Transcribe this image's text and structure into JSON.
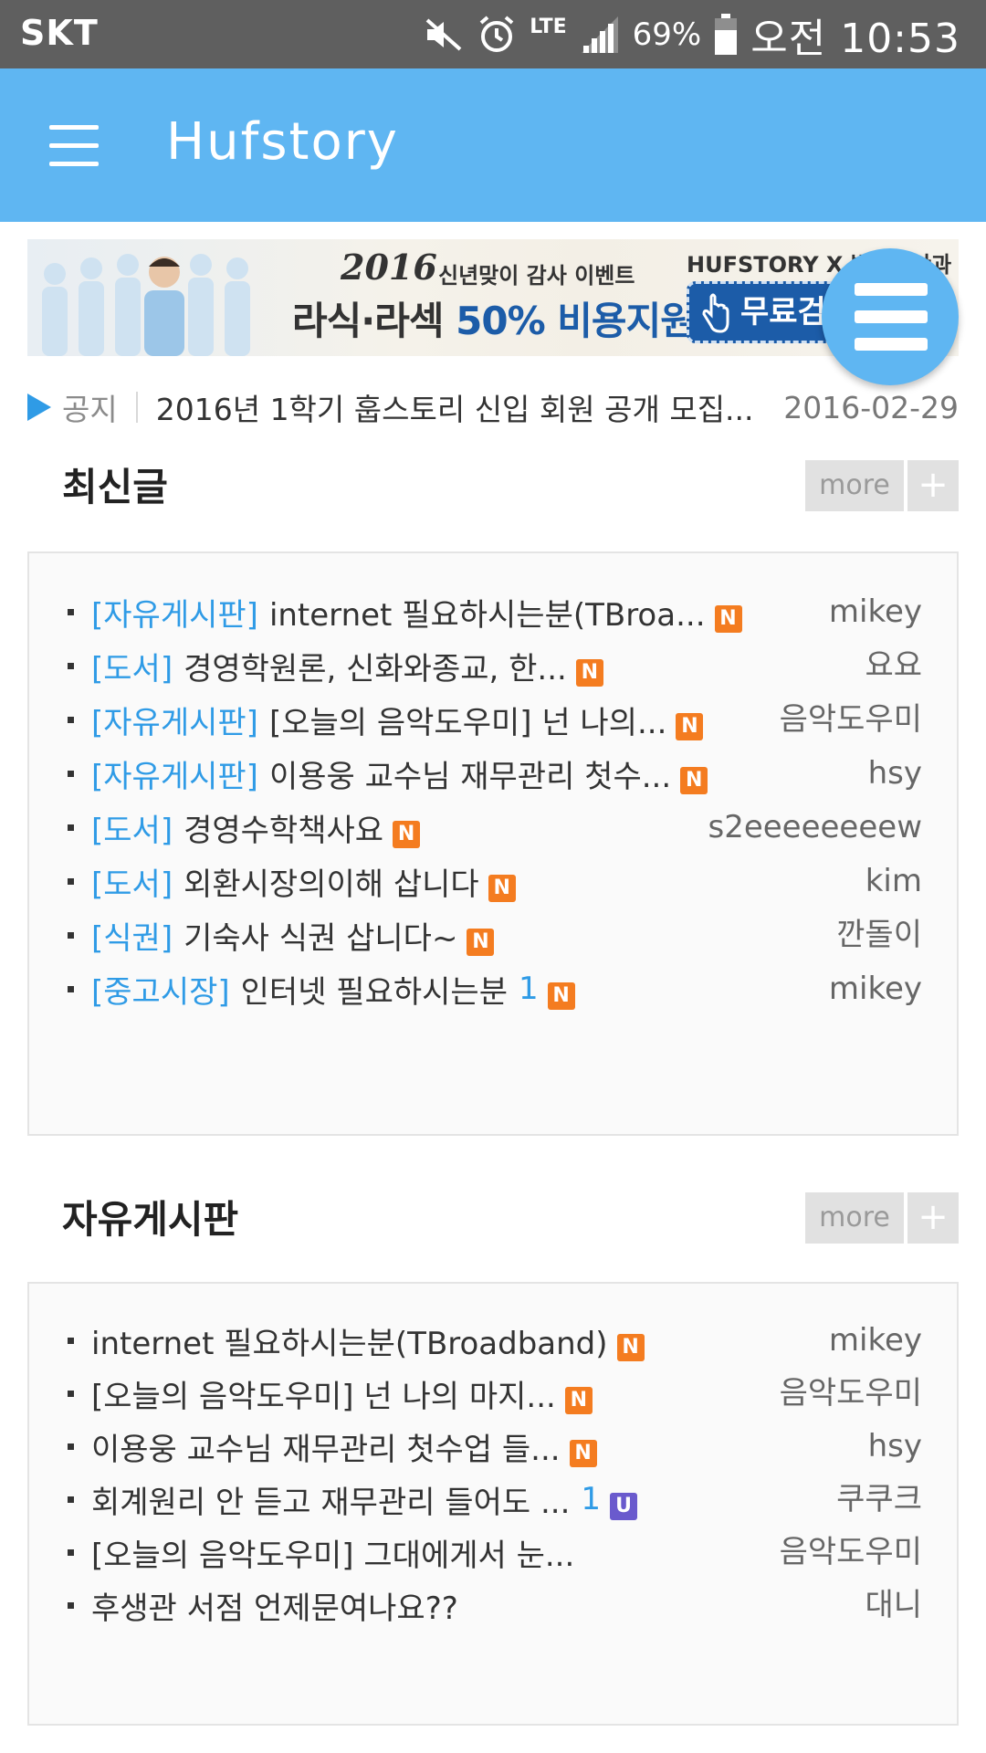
{
  "status_bar": {
    "carrier": "SKT",
    "network": "LTE",
    "battery": "69%",
    "time": "오전 10:53"
  },
  "app_bar": {
    "title": "Hufstory"
  },
  "banner": {
    "year": "2016",
    "event": "신년맞이 감사 이벤트",
    "headline_part1": "라식·라섹",
    "headline_part2": "50% 비용지원",
    "brand": "HUFSTORY X 밝은빛안과",
    "cta": "무료검진"
  },
  "notice": {
    "label": "공지",
    "title": "2016년 1학기 훕스토리 신입 회원 공개 모집...",
    "date": "2016-02-29"
  },
  "latest": {
    "title": "최신글",
    "more_label": "more",
    "plus_label": "+",
    "items": [
      {
        "category": "[자유게시판]",
        "title": "internet 필요하시는분(TBroa...",
        "count": "",
        "badge": "N",
        "author": "mikey"
      },
      {
        "category": "[도서]",
        "title": "경영학원론, 신화와종교, 한...",
        "count": "",
        "badge": "N",
        "author": "요요"
      },
      {
        "category": "[자유게시판]",
        "title": "[오늘의 음악도우미] 넌 나의...",
        "count": "",
        "badge": "N",
        "author": "음악도우미"
      },
      {
        "category": "[자유게시판]",
        "title": "이용웅 교수님 재무관리 첫수...",
        "count": "",
        "badge": "N",
        "author": "hsy"
      },
      {
        "category": "[도서]",
        "title": "경영수학책사요",
        "count": "",
        "badge": "N",
        "author": "s2eeeeeeeew"
      },
      {
        "category": "[도서]",
        "title": "외환시장의이해 삽니다",
        "count": "",
        "badge": "N",
        "author": "kim"
      },
      {
        "category": "[식권]",
        "title": "기숙사 식권 삽니다~",
        "count": "",
        "badge": "N",
        "author": "깐돌이"
      },
      {
        "category": "[중고시장]",
        "title": "인터넷 필요하시는분",
        "count": "1",
        "badge": "N",
        "author": "mikey"
      }
    ]
  },
  "free_board": {
    "title": "자유게시판",
    "more_label": "more",
    "plus_label": "+",
    "items": [
      {
        "title": "internet 필요하시는분(TBroadband)",
        "count": "",
        "badge": "N",
        "author": "mikey"
      },
      {
        "title": "[오늘의 음악도우미] 넌 나의 마지...",
        "count": "",
        "badge": "N",
        "author": "음악도우미"
      },
      {
        "title": "이용웅 교수님 재무관리 첫수업 들...",
        "count": "",
        "badge": "N",
        "author": "hsy"
      },
      {
        "title": "회계원리 안 듣고 재무관리 들어도 ...",
        "count": "1",
        "badge": "U",
        "author": "쿠쿠크"
      },
      {
        "title": "[오늘의 음악도우미] 그대에게서 눈...",
        "count": "",
        "badge": "",
        "author": "음악도우미"
      },
      {
        "title": "후생관 서점 언제문여나요??",
        "count": "",
        "badge": "",
        "author": "대니"
      }
    ]
  },
  "colors": {
    "app_bar": "#5fb6f2",
    "status_bar": "#5f5f5f",
    "category": "#2f9be6",
    "badge_new": "#f47c20",
    "badge_update": "#6a5acd"
  }
}
